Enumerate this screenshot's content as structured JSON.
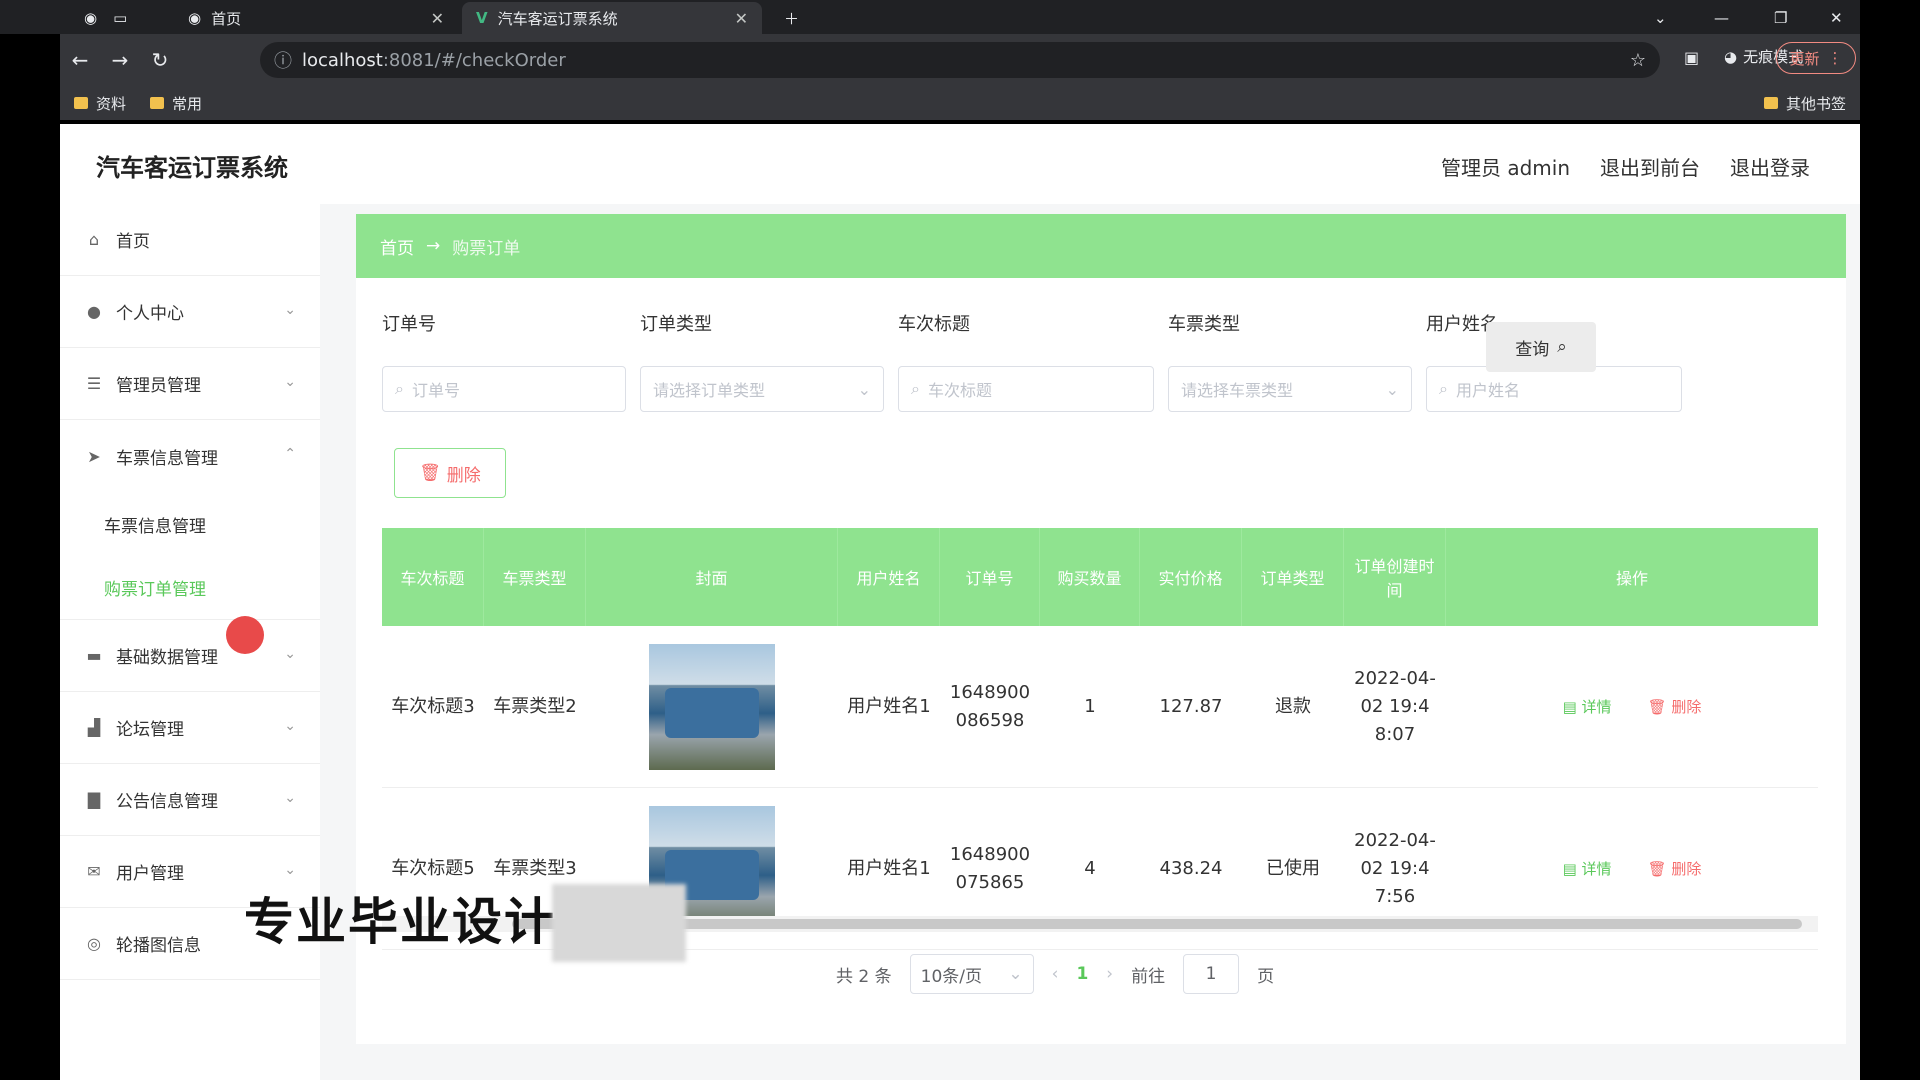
{
  "browser": {
    "tabs": [
      {
        "label": "首页"
      },
      {
        "label": "汽车客运订票系统"
      }
    ],
    "url_host": "localhost",
    "url_path": ":8081/#/checkOrder",
    "incognito_label": "无痕模式",
    "update_label": "更新",
    "bookmarks": [
      "资料",
      "常用"
    ],
    "other_bookmarks": "其他书签"
  },
  "app": {
    "title": "汽车客运订票系统",
    "user_label": "管理员 admin",
    "exit_front": "退出到前台",
    "logout": "退出登录"
  },
  "sidebar": {
    "items": [
      {
        "label": "首页",
        "icon": "home-icon"
      },
      {
        "label": "个人中心",
        "icon": "user-icon"
      },
      {
        "label": "管理员管理",
        "icon": "list-icon"
      },
      {
        "label": "车票信息管理",
        "icon": "send-icon"
      },
      {
        "label": "基础数据管理",
        "icon": "folder-icon"
      },
      {
        "label": "论坛管理",
        "icon": "forum-icon"
      },
      {
        "label": "公告信息管理",
        "icon": "notice-icon"
      },
      {
        "label": "用户管理",
        "icon": "mail-icon"
      },
      {
        "label": "轮播图信息",
        "icon": "image-icon"
      }
    ],
    "submenu": [
      "车票信息管理",
      "购票订单管理"
    ]
  },
  "breadcrumb": {
    "home": "首页",
    "arrow": "→",
    "current": "购票订单"
  },
  "filters": {
    "order_no": {
      "label": "订单号",
      "placeholder": "订单号"
    },
    "order_type": {
      "label": "订单类型",
      "placeholder": "请选择订单类型"
    },
    "trip_title": {
      "label": "车次标题",
      "placeholder": "车次标题"
    },
    "ticket_type": {
      "label": "车票类型",
      "placeholder": "请选择车票类型"
    },
    "user_name": {
      "label": "用户姓名",
      "placeholder": "用户姓名"
    },
    "query": "查询"
  },
  "actions": {
    "delete": "删除"
  },
  "table": {
    "headers": [
      "车次标题",
      "车票类型",
      "封面",
      "用户姓名",
      "订单号",
      "购买数量",
      "实付价格",
      "订单类型",
      "订单创建时间",
      "操作"
    ],
    "rows": [
      {
        "trip": "车次标题3",
        "ticket_type": "车票类型2",
        "user": "用户姓名1",
        "order_no": "1648900086598",
        "qty": "1",
        "price": "127.87",
        "order_type": "退款",
        "created": "2022-04-02 19:48:07",
        "detail": "详情",
        "del": "删除"
      },
      {
        "trip": "车次标题5",
        "ticket_type": "车票类型3",
        "user": "用户姓名1",
        "order_no": "1648900075865",
        "qty": "4",
        "price": "438.24",
        "order_type": "已使用",
        "created": "2022-04-02 19:47:56",
        "detail": "详情",
        "del": "删除"
      }
    ]
  },
  "pagination": {
    "total": "共 2 条",
    "page_size": "10条/页",
    "current_page": "1",
    "goto_label": "前往",
    "goto_value": "1",
    "page_suffix": "页"
  },
  "watermark": "专业毕业设计"
}
